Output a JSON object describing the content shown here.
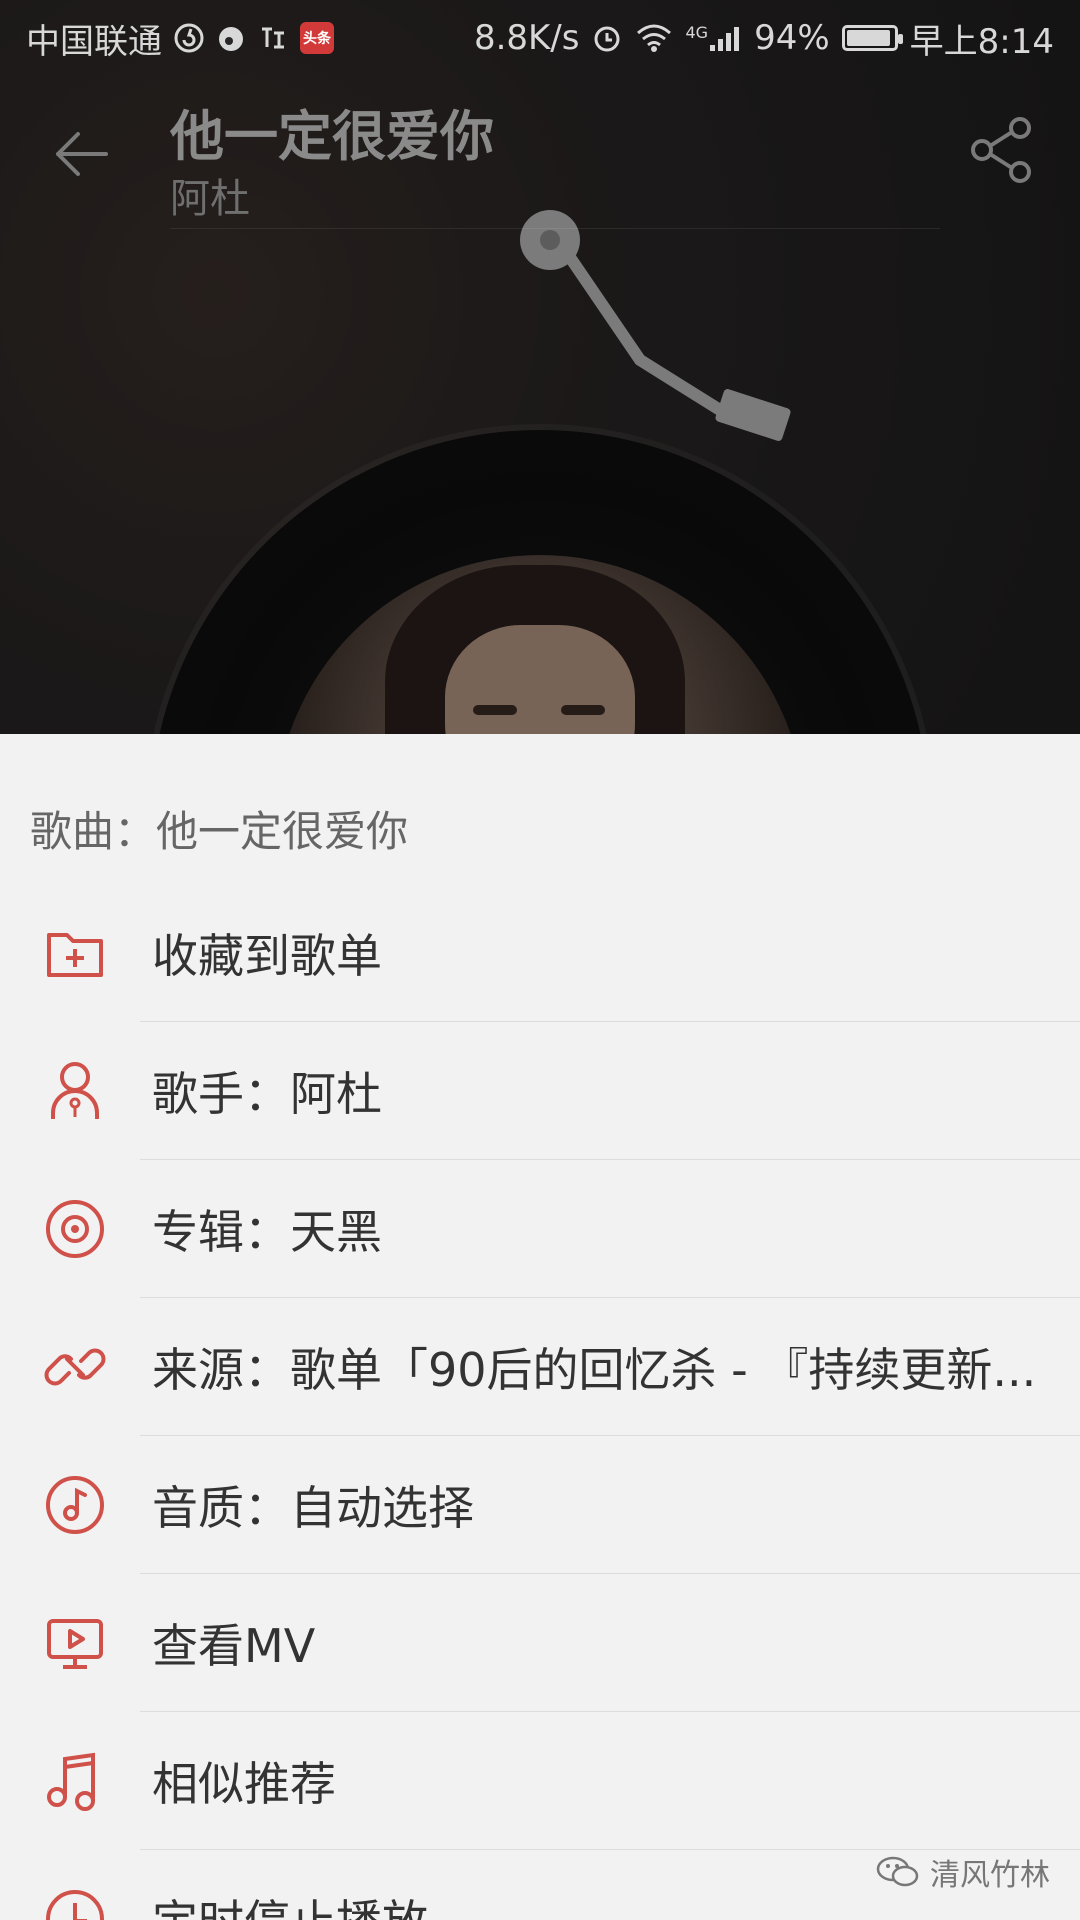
{
  "status_bar": {
    "carrier": "中国联通",
    "badge_text": "头条",
    "net_speed": "8.8K/s",
    "network_type": "4G",
    "battery": "94%",
    "battery_level": 0.94,
    "time": "早上8:14"
  },
  "header": {
    "title": "他一定很爱你",
    "artist": "阿杜"
  },
  "sheet": {
    "title": "歌曲：他一定很爱你",
    "items": [
      {
        "label": "收藏到歌单",
        "icon": "folder-add-icon"
      },
      {
        "label": "歌手：阿杜",
        "icon": "singer-icon"
      },
      {
        "label": "专辑：天黑",
        "icon": "album-disc-icon"
      },
      {
        "label": "来源：歌单「90后的回忆杀 - 『持续更新...",
        "icon": "link-icon"
      },
      {
        "label": "音质：自动选择",
        "icon": "sound-quality-icon"
      },
      {
        "label": "查看MV",
        "icon": "mv-icon"
      },
      {
        "label": "相似推荐",
        "icon": "music-note-icon"
      },
      {
        "label": "定时停止播放",
        "icon": "clock-icon"
      }
    ]
  },
  "watermark": {
    "text": "清风竹林"
  },
  "colors": {
    "accent": "#d0504a",
    "sheet_bg": "#f2f2f2"
  }
}
